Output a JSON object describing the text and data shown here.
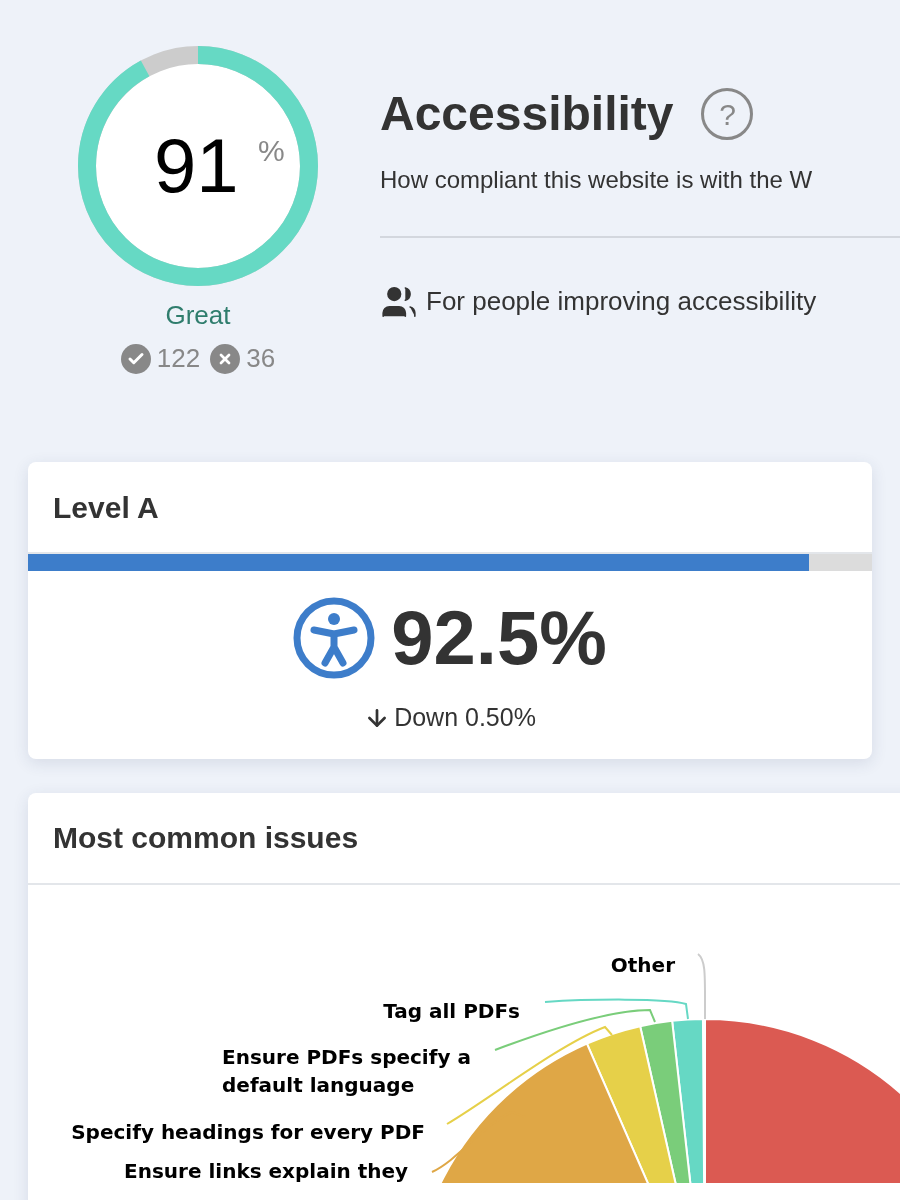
{
  "score": {
    "value": "91",
    "unit": "%",
    "level": 0.92,
    "rating": "Great",
    "passed": "122",
    "failed": "36"
  },
  "header": {
    "title": "Accessibility",
    "help": "?",
    "description": "How compliant this website is with the W",
    "audience": "For people improving accessibility"
  },
  "level_card": {
    "title": "Level A",
    "level": 0.925,
    "value": "92.5%",
    "change": "Down 0.50%"
  },
  "issues_card": {
    "title": "Most common issues",
    "slices": [
      {
        "color": "#db5a52"
      },
      {
        "label": "Other",
        "color": "#cccccc"
      },
      {
        "label": "Tag all PDFs",
        "color": "#66d8c4"
      },
      {
        "label": "Ensure PDFs specify a default language",
        "color": "#7acd7a"
      },
      {
        "label": "Specify headings for every PDF",
        "color": "#e6d049"
      },
      {
        "label": "Ensure links explain they",
        "color": "#dfa746"
      }
    ]
  }
}
